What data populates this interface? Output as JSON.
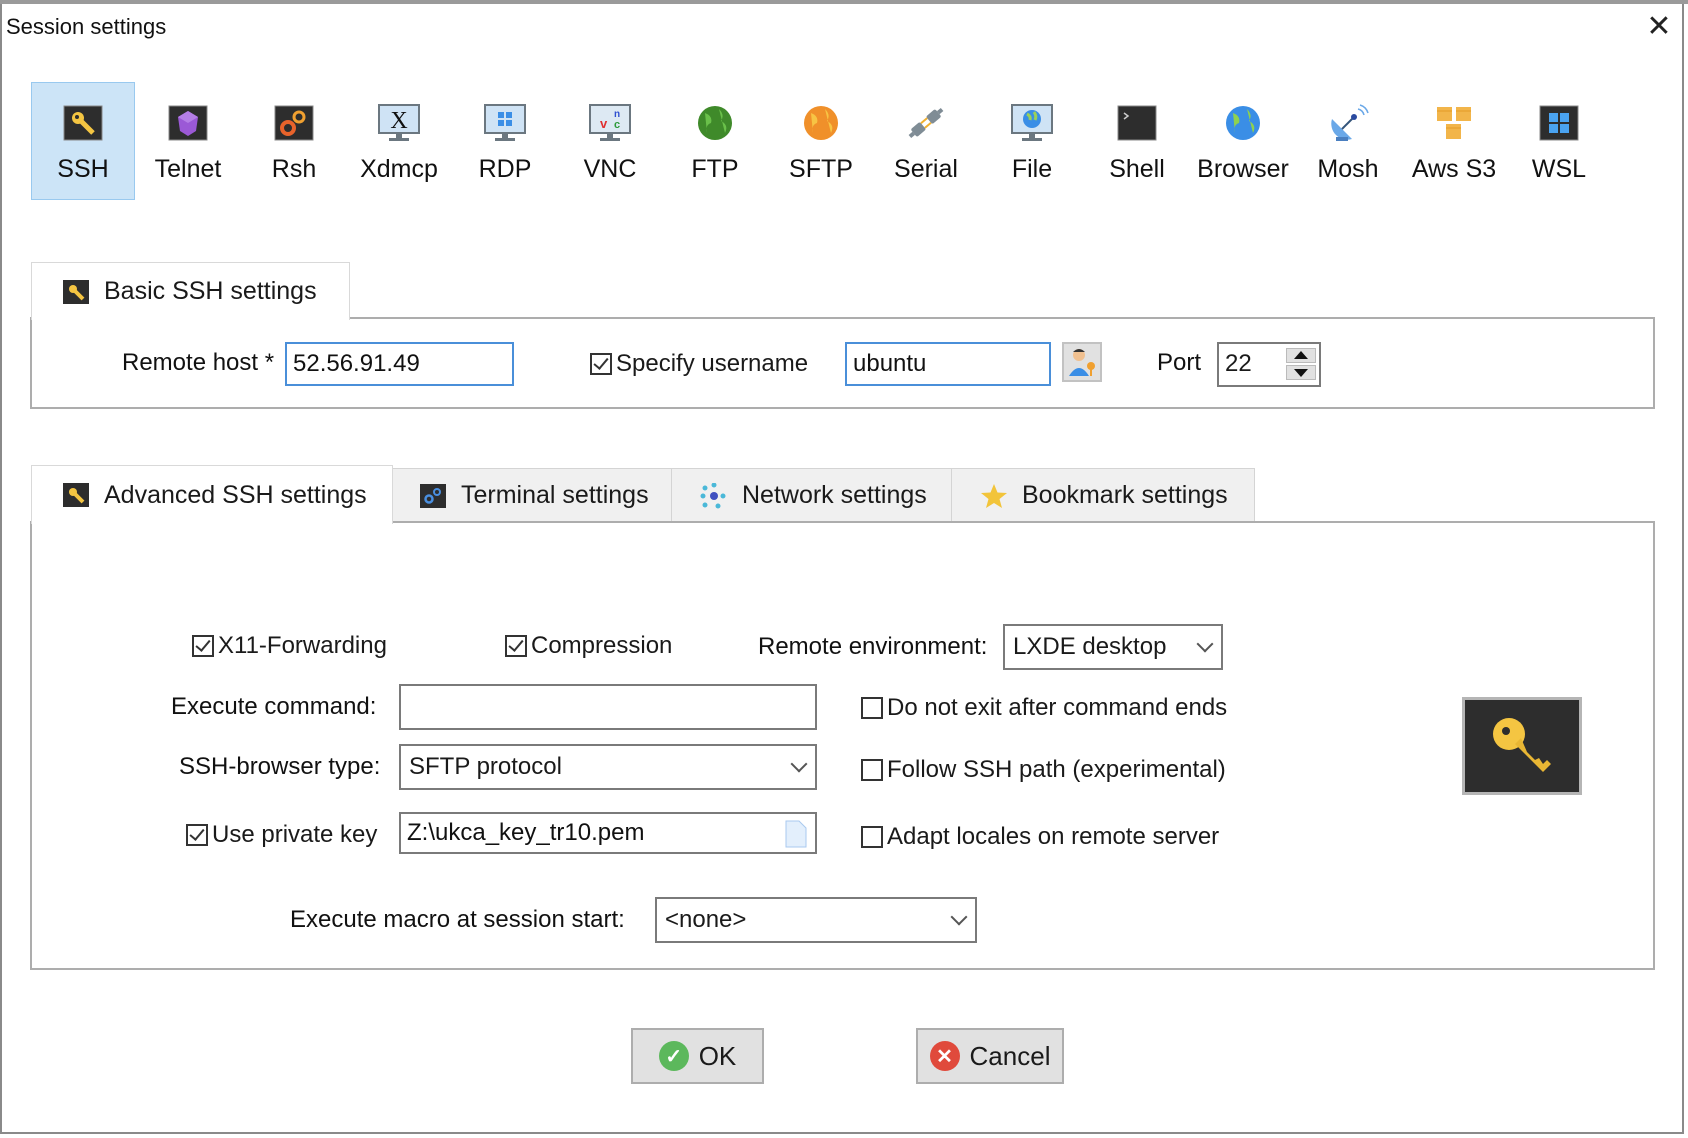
{
  "window": {
    "title": "Session settings",
    "close_icon": "close-icon"
  },
  "protocols": [
    {
      "label": "SSH",
      "icon": "ssh-key-icon",
      "selected": true
    },
    {
      "label": "Telnet",
      "icon": "telnet-gem-icon"
    },
    {
      "label": "Rsh",
      "icon": "rsh-gears-icon"
    },
    {
      "label": "Xdmcp",
      "icon": "xdmcp-monitor-icon"
    },
    {
      "label": "RDP",
      "icon": "rdp-monitor-icon"
    },
    {
      "label": "VNC",
      "icon": "vnc-monitor-icon"
    },
    {
      "label": "FTP",
      "icon": "ftp-globe-icon"
    },
    {
      "label": "SFTP",
      "icon": "sftp-globe-icon"
    },
    {
      "label": "Serial",
      "icon": "serial-plug-icon"
    },
    {
      "label": "File",
      "icon": "file-monitor-icon"
    },
    {
      "label": "Shell",
      "icon": "shell-terminal-icon"
    },
    {
      "label": "Browser",
      "icon": "browser-globe-icon"
    },
    {
      "label": "Mosh",
      "icon": "mosh-satellite-icon"
    },
    {
      "label": "Aws S3",
      "icon": "aws-s3-cubes-icon"
    },
    {
      "label": "WSL",
      "icon": "wsl-windows-icon"
    }
  ],
  "basic": {
    "tab_label": "Basic SSH settings",
    "remote_host_label": "Remote host *",
    "remote_host_value": "52.56.91.49",
    "specify_username_label": "Specify username",
    "specify_username_checked": true,
    "username_value": "ubuntu",
    "port_label": "Port",
    "port_value": "22"
  },
  "advanced_tabs": [
    {
      "label": "Advanced SSH settings",
      "icon": "key-icon",
      "active": true
    },
    {
      "label": "Terminal settings",
      "icon": "gears-icon"
    },
    {
      "label": "Network settings",
      "icon": "network-icon"
    },
    {
      "label": "Bookmark settings",
      "icon": "star-icon"
    }
  ],
  "advanced": {
    "x11_label": "X11-Forwarding",
    "x11_checked": true,
    "compression_label": "Compression",
    "compression_checked": true,
    "remote_env_label": "Remote environment:",
    "remote_env_value": "LXDE desktop",
    "exec_cmd_label": "Execute command:",
    "exec_cmd_value": "",
    "no_exit_label": "Do not exit after command ends",
    "no_exit_checked": false,
    "browser_type_label": "SSH-browser type:",
    "browser_type_value": "SFTP protocol",
    "follow_path_label": "Follow SSH path (experimental)",
    "follow_path_checked": false,
    "private_key_label": "Use private key",
    "private_key_checked": true,
    "private_key_value": "Z:\\ukca_key_tr10.pem",
    "adapt_locales_label": "Adapt locales on remote server",
    "adapt_locales_checked": false,
    "macro_label": "Execute macro at session start:",
    "macro_value": "<none>"
  },
  "buttons": {
    "ok": "OK",
    "cancel": "Cancel"
  },
  "colors": {
    "selected_bg": "#cce4f7",
    "focus_border": "#4a8fd9",
    "ok_green": "#5cb85c",
    "cancel_red": "#e04a3c",
    "key_gold": "#f4c542"
  }
}
